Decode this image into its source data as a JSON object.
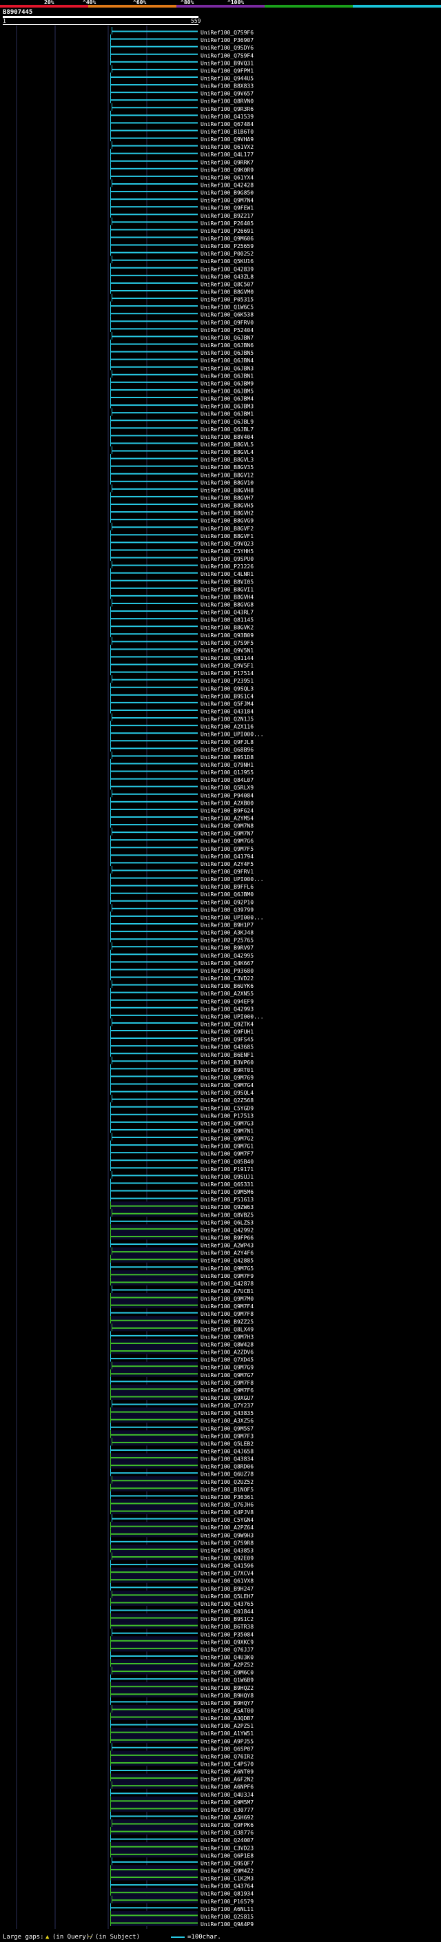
{
  "scale_labels": [
    "20%",
    "^40%",
    "^60%",
    "^80%",
    "^100%"
  ],
  "scale_colors": [
    "#e0152b",
    "#e07a18",
    "#7a2aa0",
    "#1aa01a",
    "#19c3d8"
  ],
  "query_id": "B8907445",
  "ruler": {
    "start_label": "1",
    "end_label": "559"
  },
  "colors": {
    "cyan": "#27c8e3",
    "green": "#3fbf2a",
    "navy": "#0a0a2a",
    "grid": "#2b2f5a"
  },
  "hits": [
    "UniRef100_Q7S9F6",
    "UniRef100_P36907",
    "UniRef100_Q9SDY6",
    "UniRef100_Q7S9F4",
    "UniRef100_B9VQ31",
    "UniRef100_Q9FPM1",
    "UniRef100_Q944U5",
    "UniRef100_B8X833",
    "UniRef100_Q9V657",
    "UniRef100_Q8RVN0",
    "UniRef100_Q9R3R6",
    "UniRef100_Q41539",
    "UniRef100_Q67484",
    "UniRef100_B1B6T0",
    "UniRef100_Q9VHA9",
    "UniRef100_Q61VX2",
    "UniRef100_Q4L177",
    "UniRef100_Q9RRK7",
    "UniRef100_Q9K0R9",
    "UniRef100_Q61YX4",
    "UniRef100_Q42428",
    "UniRef100_B9G850",
    "UniRef100_Q9M7N4",
    "UniRef100_Q9FEW1",
    "UniRef100_B9Z217",
    "UniRef100_P26405",
    "UniRef100_P26691",
    "UniRef100_Q9M606",
    "UniRef100_P25659",
    "UniRef100_P00252",
    "UniRef100_Q5KU16",
    "UniRef100_Q42839",
    "UniRef100_Q43ZL8",
    "UniRef100_Q8C507",
    "UniRef100_B8GVM0",
    "UniRef100_P05315",
    "UniRef100_Q1W6C5",
    "UniRef100_Q6K538",
    "UniRef100_Q9FRV0",
    "UniRef100_P52404",
    "UniRef100_Q6JBN7",
    "UniRef100_Q6JBN6",
    "UniRef100_Q6JBN5",
    "UniRef100_Q6JBN4",
    "UniRef100_Q6JBN3",
    "UniRef100_Q6JBN1",
    "UniRef100_Q6JBM9",
    "UniRef100_Q6JBM5",
    "UniRef100_Q6JBM4",
    "UniRef100_Q6JBM3",
    "UniRef100_Q6JBM1",
    "UniRef100_Q6JBL9",
    "UniRef100_Q6JBL7",
    "UniRef100_B8V404",
    "UniRef100_B8GVL5",
    "UniRef100_B8GVL4",
    "UniRef100_B8GVL3",
    "UniRef100_B8GV35",
    "UniRef100_B8GV12",
    "UniRef100_B8GV10",
    "UniRef100_B8GVH8",
    "UniRef100_B8GVH7",
    "UniRef100_B8GVH5",
    "UniRef100_B8GVH2",
    "UniRef100_B8GVG9",
    "UniRef100_B8GVF2",
    "UniRef100_B8GVF1",
    "UniRef100_Q9VQ23",
    "UniRef100_C5YHH5",
    "UniRef100_Q9SPU0",
    "UniRef100_P21226",
    "UniRef100_C4LNR1",
    "UniRef100_B8VI05",
    "UniRef100_B8GVI1",
    "UniRef100_B8GVH4",
    "UniRef100_B8GVG8",
    "UniRef100_Q43RL7",
    "UniRef100_Q81145",
    "UniRef100_B8GVK2",
    "UniRef100_Q93B09",
    "UniRef100_Q7S9F5",
    "UniRef100_Q9V5N1",
    "UniRef100_Q81144",
    "UniRef100_Q9V5F1",
    "UniRef100_P17514",
    "UniRef100_P23951",
    "UniRef100_Q9SQL3",
    "UniRef100_B9S1C4",
    "UniRef100_Q5FJM4",
    "UniRef100_Q43184",
    "UniRef100_Q2N1J5",
    "UniRef100_A2X116",
    "UniRef100_UPI000...",
    "UniRef100_Q9FJL8",
    "UniRef100_Q68B96",
    "UniRef100_B9S1D8",
    "UniRef100_Q79NH1",
    "UniRef100_Q1J955",
    "UniRef100_Q84L07",
    "UniRef100_Q5RLX9",
    "UniRef100_P94084",
    "UniRef100_A2XB00",
    "UniRef100_B9FG24",
    "UniRef100_A2YM54",
    "UniRef100_Q9M7N8",
    "UniRef100_Q9M7N7",
    "UniRef100_Q9M7G6",
    "UniRef100_Q9M7F5",
    "UniRef100_Q41794",
    "UniRef100_A2Y4F5",
    "UniRef100_Q9FRV1",
    "UniRef100_UPI000...",
    "UniRef100_B9FFL6",
    "UniRef100_Q6JBM0",
    "UniRef100_Q92P10",
    "UniRef100_Q39799",
    "UniRef100_UPI000...",
    "UniRef100_B9H1P7",
    "UniRef100_A3KJ48",
    "UniRef100_P25765",
    "UniRef100_B9RV97",
    "UniRef100_Q42995",
    "UniRef100_Q4K667",
    "UniRef100_P93680",
    "UniRef100_C3VD22",
    "UniRef100_B6UYK6",
    "UniRef100_A2XN55",
    "UniRef100_Q94EF9",
    "UniRef100_Q42993",
    "UniRef100_UPI000...",
    "UniRef100_Q9ZTK4",
    "UniRef100_Q9FUH1",
    "UniRef100_Q9FS45",
    "UniRef100_Q43685",
    "UniRef100_B6ENF1",
    "UniRef100_B3VP60",
    "UniRef100_B9RT01",
    "UniRef100_Q9M769",
    "UniRef100_Q9M7G4",
    "UniRef100_Q9SQL4",
    "UniRef100_Q2Z568",
    "UniRef100_C5YGD9",
    "UniRef100_P17513",
    "UniRef100_Q9M7G3",
    "UniRef100_Q9M7N1",
    "UniRef100_Q9M7G2",
    "UniRef100_Q9M7G1",
    "UniRef100_Q9M7F7",
    "UniRef100_Q05B40",
    "UniRef100_P19171",
    "UniRef100_Q9SUJ1",
    "UniRef100_Q6S331",
    "UniRef100_Q9M5M6",
    "UniRef100_P51613",
    "UniRef100_Q9ZW63",
    "UniRef100_Q8VBZ5",
    "UniRef100_Q6LZS3",
    "UniRef100_Q42992",
    "UniRef100_B9FP66",
    "UniRef100_A2WP43",
    "UniRef100_A2Y4F6",
    "UniRef100_Q42885",
    "UniRef100_Q9M7G5",
    "UniRef100_Q9M7F9",
    "UniRef100_Q42878",
    "UniRef100_A7UCB1",
    "UniRef100_Q9M7M0",
    "UniRef100_Q9M7F4",
    "UniRef100_Q9M7F8",
    "UniRef100_B9ZZ25",
    "UniRef100_Q8LX49",
    "UniRef100_Q9M7H3",
    "UniRef100_Q8W428",
    "UniRef100_A2ZDV6",
    "UniRef100_Q7XD45",
    "UniRef100_Q9M7G9",
    "UniRef100_Q9M7G7",
    "UniRef100_Q9M7F8",
    "UniRef100_Q9M7F6",
    "UniRef100_Q9XGU7",
    "UniRef100_Q7Y237",
    "UniRef100_Q43835",
    "UniRef100_A3XZ56",
    "UniRef100_Q9M5S7",
    "UniRef100_Q9M7F3",
    "UniRef100_Q5LEB2",
    "UniRef100_Q4J658",
    "UniRef100_Q43834",
    "UniRef100_Q8RD06",
    "UniRef100_Q6UZ78",
    "UniRef100_Q2UZ52",
    "UniRef100_B1NOF5",
    "UniRef100_P36361",
    "UniRef100_Q76JH6",
    "UniRef100_Q4PJV8",
    "UniRef100_C5YGN4",
    "UniRef100_A2PZ64",
    "UniRef100_Q9W9H3",
    "UniRef100_Q7S9R8",
    "UniRef100_Q43853",
    "UniRef100_Q92E09",
    "UniRef100_Q41596",
    "UniRef100_Q7XCV4",
    "UniRef100_Q61VX8",
    "UniRef100_B9H247",
    "UniRef100_Q5LEH7",
    "UniRef100_Q43765",
    "UniRef100_Q01844",
    "UniRef100_B9S1C2",
    "UniRef100_B6TR38",
    "UniRef100_P35084",
    "UniRef100_Q9XKC9",
    "UniRef100_Q76JJ7",
    "UniRef100_Q4U3K0",
    "UniRef100_A2PZ52",
    "UniRef100_Q9M6C0",
    "UniRef100_Q1W6B9",
    "UniRef100_B9HQZ2",
    "UniRef100_B9HQY8",
    "UniRef100_B9HQY7",
    "UniRef100_A5AT00",
    "UniRef100_A3QDB7",
    "UniRef100_A2PZ51",
    "UniRef100_A1YW51",
    "UniRef100_A9PJ55",
    "UniRef100_Q6SP07",
    "UniRef100_Q76IR2",
    "UniRef100_C4PS70",
    "UniRef100_A6NT09",
    "UniRef100_A6F2N2",
    "UniRef100_A6NPF6",
    "UniRef100_Q4U3J4",
    "UniRef100_Q9M5M7",
    "UniRef100_Q30777",
    "UniRef100_A5H692",
    "UniRef100_Q9FPK6",
    "UniRef100_Q38776",
    "UniRef100_Q24007",
    "UniRef100_C3VD23",
    "UniRef100_Q6P1E8",
    "UniRef100_Q9SQF7",
    "UniRef100_Q9M4Z2",
    "UniRef100_C1K2M3",
    "UniRef100_Q43764",
    "UniRef100_Q81934",
    "UniRef100_P16579",
    "UniRef100_A6NL11",
    "UniRef100_Q2S815",
    "UniRef100_Q9A4P9"
  ],
  "legend": {
    "large_gaps": "Large gaps:",
    "in_query": "(in Query)/",
    "in_subject": "(in Subject)",
    "scale": "=100char."
  }
}
